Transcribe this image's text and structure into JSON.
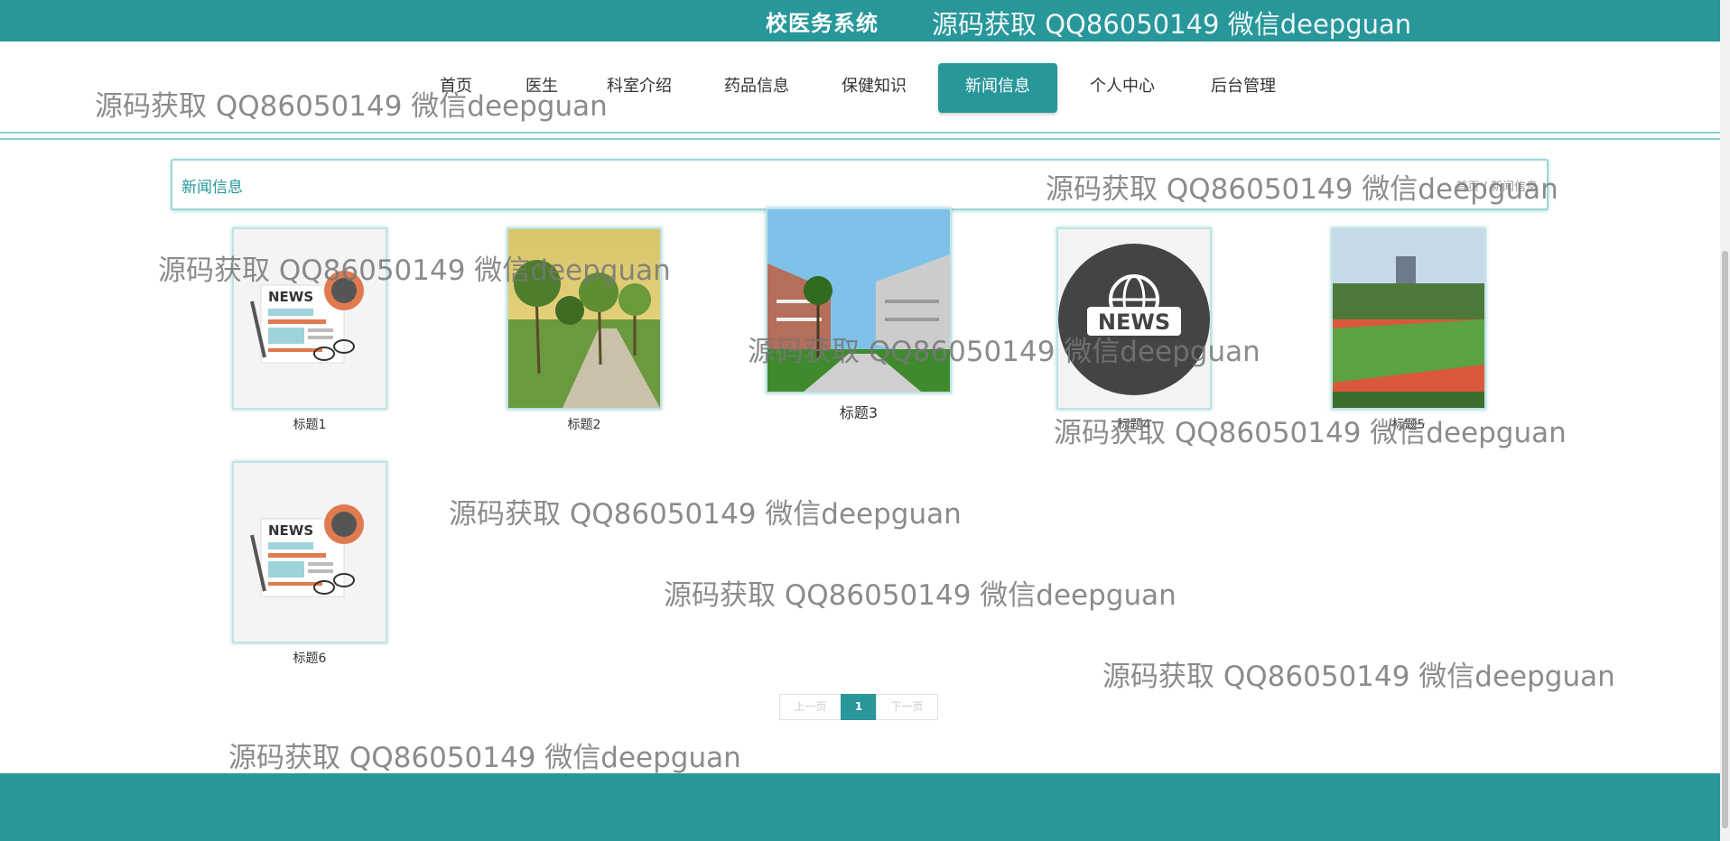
{
  "header": {
    "site_title": "校医务系统",
    "watermark": "源码获取 QQ86050149 微信deepguan"
  },
  "nav": {
    "items": [
      {
        "label": "首页"
      },
      {
        "label": "医生"
      },
      {
        "label": "科室介绍"
      },
      {
        "label": "药品信息"
      },
      {
        "label": "保健知识"
      },
      {
        "label": "新闻信息"
      },
      {
        "label": "个人中心"
      },
      {
        "label": "后台管理"
      }
    ],
    "active": "新闻信息"
  },
  "panel": {
    "title": "新闻信息",
    "breadcrumb": "首页 / 新闻信息"
  },
  "news": [
    {
      "title": "标题1",
      "image": "newspaper-coffee-icon"
    },
    {
      "title": "标题2",
      "image": "campus-trees-photo"
    },
    {
      "title": "标题3",
      "image": "campus-courtyard-photo"
    },
    {
      "title": "标题4",
      "image": "news-globe-icon"
    },
    {
      "title": "标题5",
      "image": "sports-field-photo"
    },
    {
      "title": "标题6",
      "image": "newspaper-coffee-icon"
    }
  ],
  "pager": {
    "prev": "上一页",
    "current": "1",
    "next": "下一页"
  },
  "colors": {
    "accent": "#27979a"
  },
  "watermarks": [
    "源码获取 QQ86050149 微信deepguan",
    "源码获取 QQ86050149 微信deepguan",
    "源码获取 QQ86050149 微信deepguan",
    "源码获取 QQ86050149 微信deepguan",
    "源码获取 QQ86050149 微信deepguan",
    "源码获取 QQ86050149 微信deepguan",
    "源码获取 QQ86050149 微信deepguan",
    "源码获取 QQ86050149 微信deepguan",
    "源码获取 QQ86050149 微信deepguan"
  ]
}
